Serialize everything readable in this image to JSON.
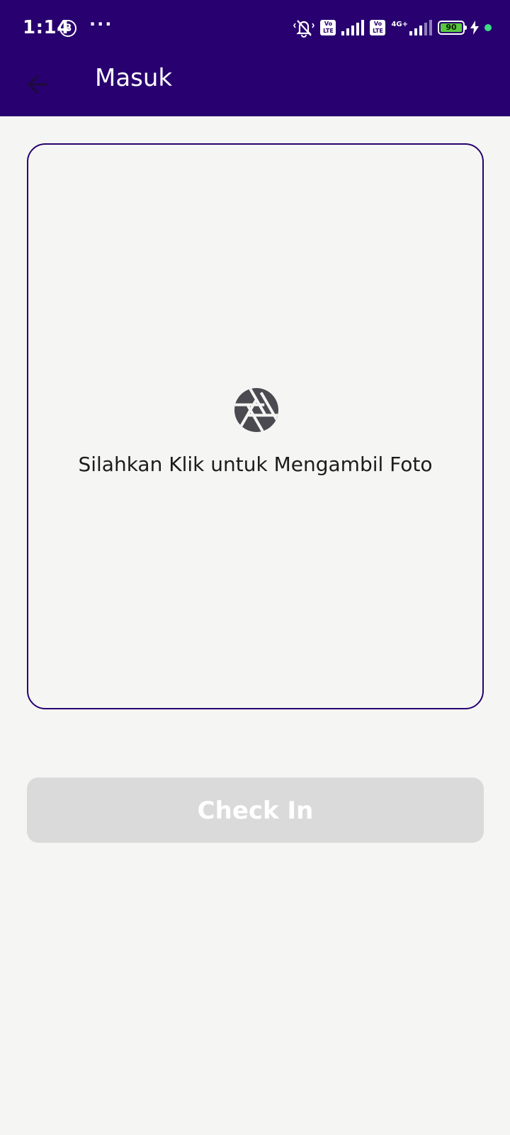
{
  "status_bar": {
    "time": "1:14",
    "bbm_badge": "B",
    "more_dots": "···",
    "volte1": "Vo LTE",
    "volte2": "Vo LTE",
    "network_type": "4G+",
    "battery_level": "90",
    "icons": [
      "silent-icon",
      "signal-icon",
      "charging-icon"
    ],
    "colors": {
      "background": "#28006f",
      "battery_fill": "#58c940",
      "dot": "#3ddc84"
    }
  },
  "app_bar": {
    "title": "Masuk",
    "back_icon": "arrow-left-icon"
  },
  "photo_card": {
    "icon": "camera-aperture-icon",
    "prompt": "Silahkan Klik untuk Mengambil Foto",
    "border_color": "#28006f"
  },
  "checkin_button": {
    "label": "Check In",
    "state": "disabled",
    "color": "#d9dad9"
  }
}
